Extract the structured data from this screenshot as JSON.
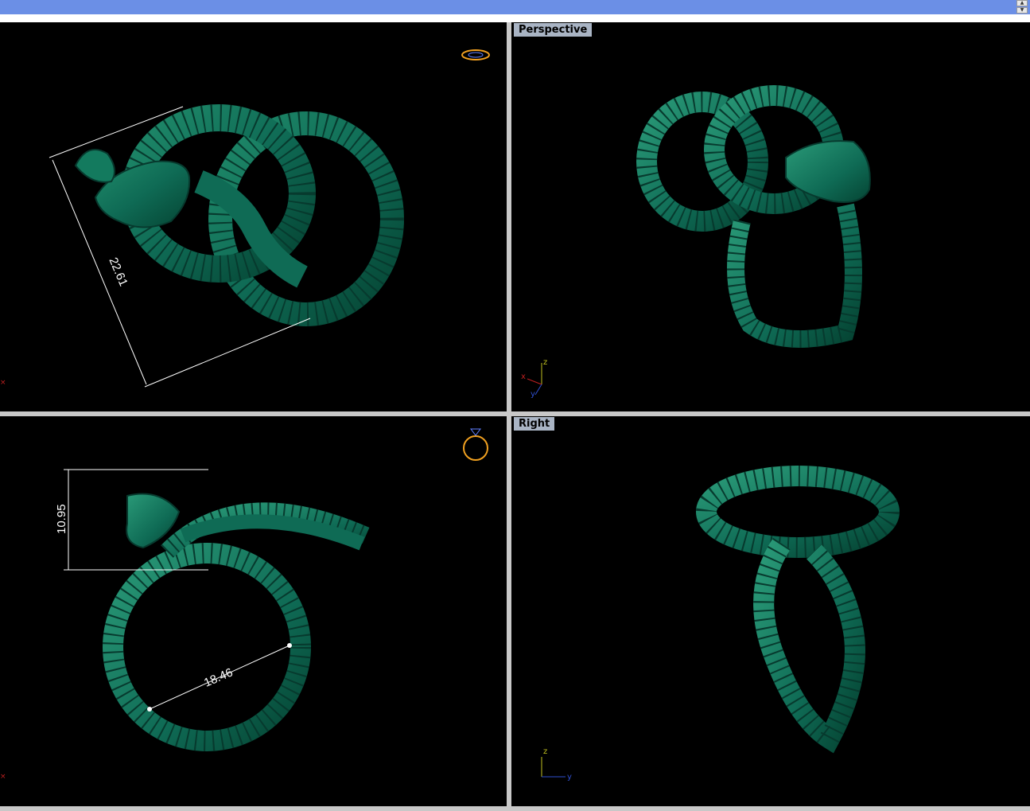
{
  "viewports": {
    "top": {
      "label": "",
      "dimension": "22.61"
    },
    "perspective": {
      "label": "Perspective",
      "axes": {
        "x": "x",
        "y": "y",
        "z": "z"
      }
    },
    "front": {
      "label": "",
      "dimension_height": "10.95",
      "dimension_diameter": "18.46"
    },
    "right": {
      "label": "Right",
      "axes": {
        "y": "y",
        "z": "z"
      }
    }
  },
  "colors": {
    "model": "#0f6b55",
    "model_highlight": "#3fb892",
    "grid_line": "#073a2e",
    "title_bar": "#6b8fe6",
    "label_bg": "#a9b4c4",
    "x_axis": "#c02020",
    "y_axis": "#3050d0",
    "z_axis": "#c0c020",
    "ring_icon": "#f0a020"
  }
}
